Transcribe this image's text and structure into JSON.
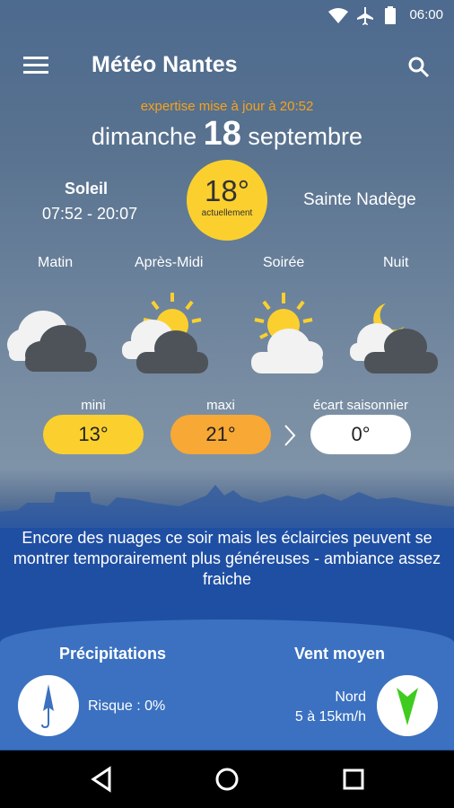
{
  "status": {
    "time": "06:00"
  },
  "app": {
    "title": "Météo Nantes"
  },
  "update": {
    "text": "expertise mise à jour à 20:52"
  },
  "date": {
    "weekday": "dimanche",
    "day": "18",
    "month": "septembre"
  },
  "sun": {
    "label": "Soleil",
    "times": "07:52 - 20:07"
  },
  "current": {
    "temp": "18°",
    "sub": "actuellement"
  },
  "saint": "Sainte Nadège",
  "periods": [
    {
      "label": "Matin",
      "icon": "cloudy-icon"
    },
    {
      "label": "Après-Midi",
      "icon": "sun-behind-clouds-icon"
    },
    {
      "label": "Soirée",
      "icon": "sun-small-cloud-icon"
    },
    {
      "label": "Nuit",
      "icon": "moon-clouds-icon"
    }
  ],
  "temps": {
    "min_label": "mini",
    "min": "13°",
    "max_label": "maxi",
    "max": "21°",
    "season_label": "écart saisonnier",
    "season": "0°"
  },
  "forecast": {
    "text": "Encore des nuages ce soir mais les éclaircies peuvent se montrer temporairement plus généreuses - ambiance assez fraiche"
  },
  "precip": {
    "title": "Précipitations",
    "risk": "Risque : 0%",
    "icon": "umbrella-icon"
  },
  "wind": {
    "title": "Vent moyen",
    "direction": "Nord",
    "speed": "5 à 15km/h",
    "icon": "wind-arrow-icon"
  },
  "colors": {
    "min_pill": "#fbd02e",
    "max_pill": "#f7a835",
    "update_text": "#f7a21c",
    "band": "#1f4fa3",
    "arrow": "#3fcc1f"
  }
}
